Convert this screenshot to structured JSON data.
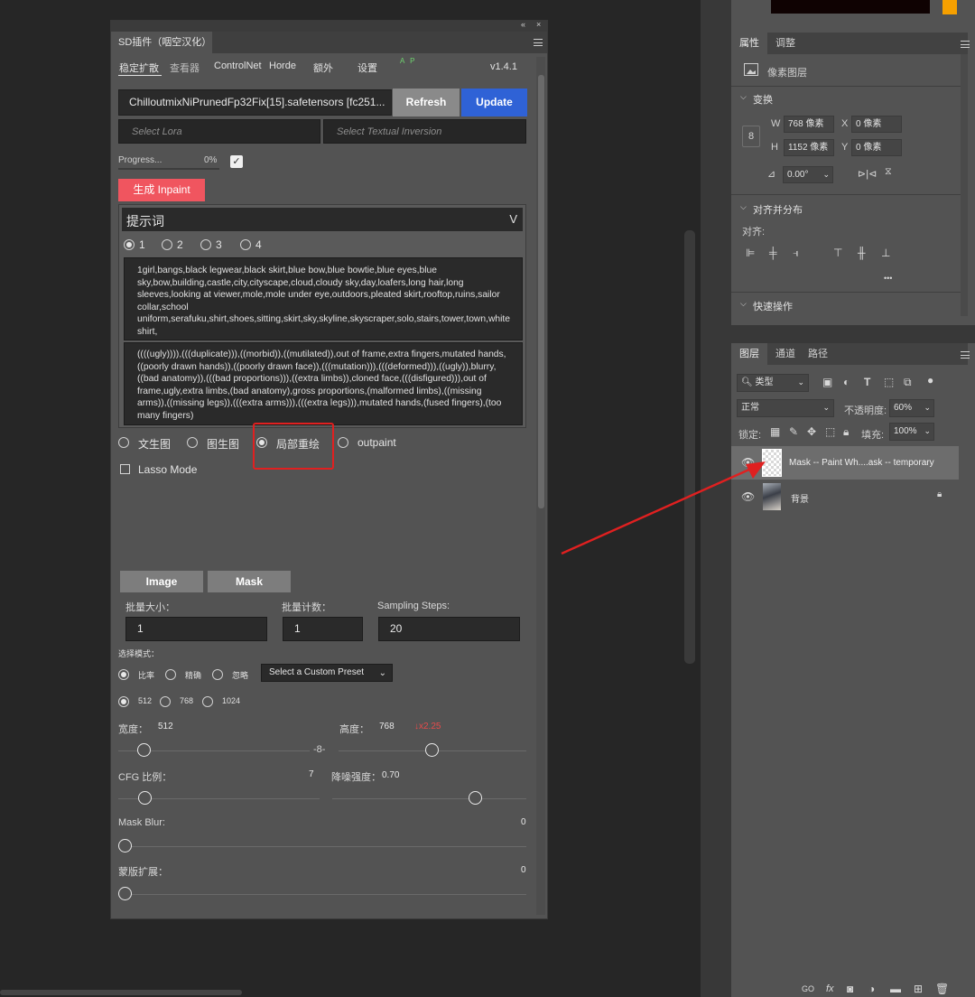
{
  "sd_panel": {
    "top_controls": [
      "«",
      "×"
    ],
    "tab_title": "SD插件（咽空汉化）",
    "nav": [
      "稳定扩散",
      "查看器",
      "ControlNet",
      "Horde",
      "额外",
      "设置"
    ],
    "nav_badge": "A P",
    "version": "v1.4.1",
    "model_value": "ChilloutmixNiPrunedFp32Fix[15].safetensors [fc251...",
    "refresh_label": "Refresh",
    "update_label": "Update",
    "lora_placeholder": "Select Lora",
    "ti_placeholder": "Select Textual Inversion",
    "progress_label": "Progress...",
    "progress_pct": "0%",
    "progress_value": 0,
    "progress_check": "✓",
    "generate_label": "生成 Inpaint",
    "prompt_title": "提示词",
    "prompt_chevron": "V",
    "prompt_slots": [
      "1",
      "2",
      "3",
      "4"
    ],
    "positive_prompt": "1girl,bangs,black legwear,black skirt,blue bow,blue bowtie,blue eyes,blue sky,bow,building,castle,city,cityscape,cloud,cloudy sky,day,loafers,long hair,long sleeves,looking at viewer,mole,mole under eye,outdoors,pleated skirt,rooftop,ruins,sailor collar,school uniform,serafuku,shirt,shoes,sitting,skirt,sky,skyline,skyscraper,solo,stairs,tower,town,white shirt,",
    "negative_prompt": "((((ugly)))),(((duplicate))),((morbid)),((mutilated)),out of frame,extra fingers,mutated hands,((poorly drawn hands)),((poorly drawn face)),(((mutation))),(((deformed))),((ugly)),blurry,((bad anatomy)),(((bad proportions))),((extra limbs)),cloned face,(((disfigured))),out of frame,ugly,extra limbs,(bad anatomy),gross proportions,(malformed limbs),((missing arms)),((missing legs)),(((extra arms))),(((extra legs))),mutated hands,(fused fingers),(too many fingers)",
    "modes": [
      "文生图",
      "图生图",
      "局部重绘",
      "outpaint"
    ],
    "lasso_label": "Lasso Mode",
    "image_btn": "Image",
    "mask_btn": "Mask",
    "batch_size_label": "批量大小：",
    "batch_count_label": "批量计数：",
    "steps_label": "Sampling Steps:",
    "batch_size": "1",
    "batch_count": "1",
    "steps": "20",
    "select_mode_label": "选择模式：",
    "mode_options": [
      "比率",
      "精确",
      "忽略"
    ],
    "preset_value": "Select a Custom Preset",
    "size_options": [
      "512",
      "768",
      "1024"
    ],
    "width_label": "宽度：",
    "width_value": "512",
    "height_label": "高度：",
    "height_value": "768",
    "scale_note": "↓x2.25",
    "link_icon": "-8-",
    "cfg_label": "CFG 比例：",
    "cfg_value": "7",
    "denoise_label": "降噪强度：",
    "denoise_value": "0.70",
    "mask_blur_label": "Mask Blur:",
    "mask_blur_value": "0",
    "mask_expand_label": "蒙版扩展：",
    "mask_expand_value": "0",
    "sliders": {
      "width": 0.1,
      "height": 0.46,
      "cfg": 0.1,
      "denoise": 0.7,
      "mask_blur": 0,
      "mask_expand": 0
    }
  },
  "properties_panel": {
    "tabs": [
      "属性",
      "调整"
    ],
    "layer_type": "像素图层",
    "transform_title": "变换",
    "w_label": "W",
    "w_value": "768 像素",
    "h_label": "H",
    "h_value": "1152 像素",
    "x_label": "X",
    "x_value": "0 像素",
    "y_label": "Y",
    "y_value": "0 像素",
    "angle_value": "0.00°",
    "align_title": "对齐并分布",
    "align_label": "对齐:",
    "more": "•••",
    "quick_title": "快速操作"
  },
  "layers_panel": {
    "tabs": [
      "图层",
      "通道",
      "路径"
    ],
    "filter_value": "类型",
    "blend_mode": "正常",
    "opacity_label": "不透明度:",
    "opacity_value": "60%",
    "lock_label": "锁定:",
    "fill_label": "填充:",
    "fill_value": "100%",
    "layers": [
      {
        "name": "Mask -- Paint Wh....ask -- temporary"
      },
      {
        "name": "背景"
      }
    ],
    "bottom_tools": [
      "GO",
      "fx"
    ]
  },
  "colors": {
    "accent_red": "#f0555f",
    "update_blue": "#2f62d6",
    "highlight": "#e02020",
    "scale_note": "#e64b4b"
  }
}
